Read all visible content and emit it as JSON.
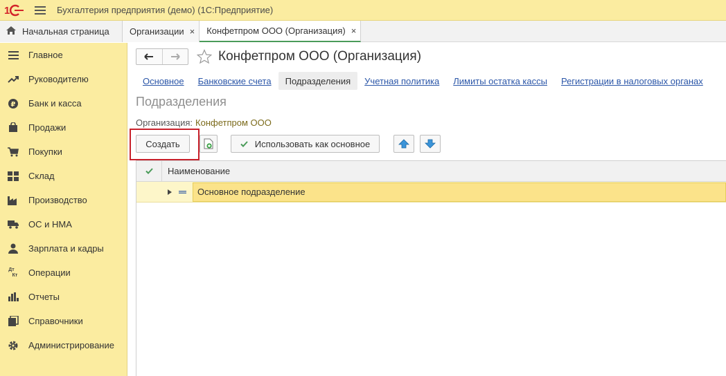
{
  "window": {
    "title": "Бухгалтерия предприятия (демо)   (1С:Предприятие)",
    "logo_text": "1С"
  },
  "tabs": {
    "home_label": "Начальная страница",
    "items": [
      {
        "label": "Организации",
        "close": "×"
      },
      {
        "label": "Конфетпром ООО (Организация)",
        "close": "×"
      }
    ]
  },
  "sidebar": {
    "items": [
      {
        "label": "Главное",
        "icon": "menu-lines-icon"
      },
      {
        "label": "Руководителю",
        "icon": "trend-icon"
      },
      {
        "label": "Банк и касса",
        "icon": "ruble-icon"
      },
      {
        "label": "Продажи",
        "icon": "bag-icon"
      },
      {
        "label": "Покупки",
        "icon": "cart-icon"
      },
      {
        "label": "Склад",
        "icon": "warehouse-icon"
      },
      {
        "label": "Производство",
        "icon": "factory-icon"
      },
      {
        "label": "ОС и НМА",
        "icon": "truck-icon"
      },
      {
        "label": "Зарплата и кадры",
        "icon": "person-icon"
      },
      {
        "label": "Операции",
        "icon": "dt-kt-icon",
        "icon_text_top": "Дт",
        "icon_text_bottom": "Кт"
      },
      {
        "label": "Отчеты",
        "icon": "bar-chart-icon"
      },
      {
        "label": "Справочники",
        "icon": "books-icon"
      },
      {
        "label": "Администрирование",
        "icon": "gear-icon"
      }
    ]
  },
  "form": {
    "title": "Конфетпром ООО (Организация)",
    "subtabs": [
      {
        "label": "Основное",
        "active": false
      },
      {
        "label": "Банковские счета",
        "active": false
      },
      {
        "label": "Подразделения",
        "active": true
      },
      {
        "label": "Учетная политика",
        "active": false
      },
      {
        "label": "Лимиты остатка кассы",
        "active": false
      },
      {
        "label": "Регистрации в налоговых органах",
        "active": false
      }
    ],
    "section_title": "Подразделения",
    "org_label": "Организация:",
    "org_value": "Конфетпром ООО",
    "toolbar": {
      "create_label": "Создать",
      "use_as_main_label": "Использовать как основное"
    },
    "grid": {
      "column_name": "Наименование",
      "rows": [
        {
          "name": "Основное подразделение"
        }
      ]
    }
  },
  "colors": {
    "titlebar_bg": "#fbeca0",
    "sidebar_bg": "#fbeca0",
    "accent_green": "#4a9b59",
    "link_blue": "#2b56a8",
    "highlight_red": "#c8202a",
    "selected_row": "#fbe38a"
  }
}
